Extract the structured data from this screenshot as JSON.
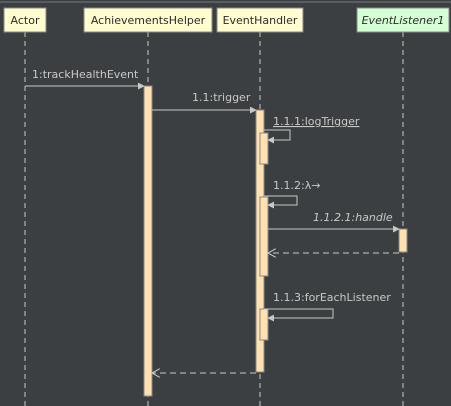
{
  "diagram": {
    "participants": [
      {
        "name": "Actor"
      },
      {
        "name": "AchievementsHelper"
      },
      {
        "name": "EventHandler"
      },
      {
        "name": "EventListener1"
      }
    ],
    "messages": [
      {
        "label": "1:trackHealthEvent"
      },
      {
        "label": "1.1:trigger"
      },
      {
        "label": "1.1.1:logTrigger"
      },
      {
        "label": "1.1.2:λ→"
      },
      {
        "label": "1.1.2.1:handle"
      },
      {
        "label": "1.1.3:forEachListener"
      }
    ]
  },
  "colors": {
    "background": "#3c3f41",
    "participant_fill": "#fffdd0",
    "participant_fill_alt": "#d4ffd4",
    "activation_fill": "#ffe0b0",
    "line": "#c8c8c8"
  }
}
